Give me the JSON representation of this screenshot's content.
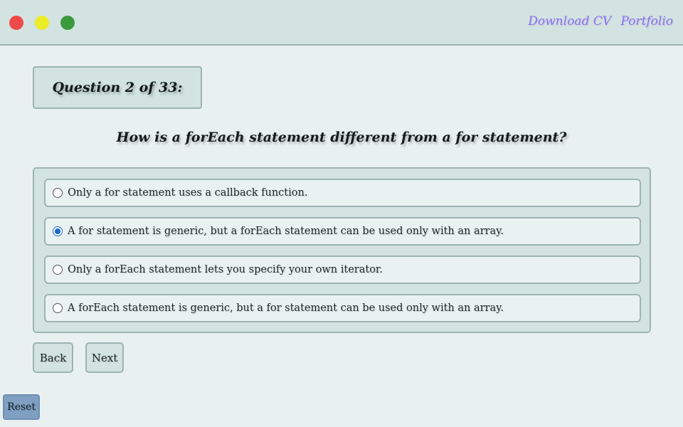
{
  "window": {
    "controls": [
      "close",
      "minimize",
      "maximize"
    ],
    "colors": {
      "close": "#ef4a4a",
      "minimize": "#ecec28",
      "maximize": "#3b9a3b"
    }
  },
  "header": {
    "links": {
      "download_cv": "Download CV",
      "portfolio": "Portfolio"
    },
    "link_color": "#8a73ee"
  },
  "quiz": {
    "counter_label": "Question 2 of 33:",
    "current": 2,
    "total": 33,
    "question": "How is a forEach statement different from a for statement?",
    "options": [
      {
        "label": "Only a for statement uses a callback function.",
        "selected": false
      },
      {
        "label": "A for statement is generic, but a forEach statement can be used only with an array.",
        "selected": true
      },
      {
        "label": "Only a forEach statement lets you specify your own iterator.",
        "selected": false
      },
      {
        "label": "A forEach statement is generic, but a for statement can be used only with an array.",
        "selected": false
      }
    ]
  },
  "buttons": {
    "back": "Back",
    "next": "Next",
    "reset": "Reset"
  },
  "colors": {
    "background": "#e9f1f0",
    "panel": "#d3e3e1",
    "border": "#9cb5b2",
    "reset": "#7fa0c2",
    "radio_selected": "#1a66d6"
  }
}
